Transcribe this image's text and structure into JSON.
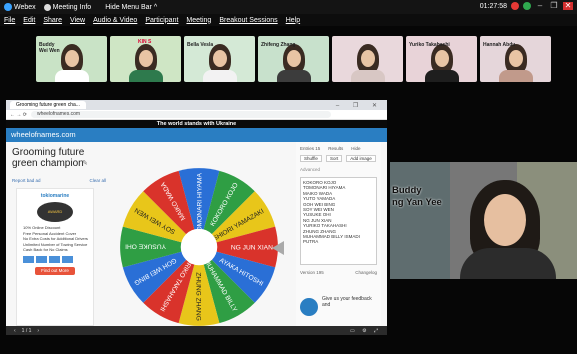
{
  "topbar": {
    "app_name": "Webex",
    "meeting_info": "Meeting Info",
    "hide_menu": "Hide Menu Bar",
    "hide_menu_chevron": "^",
    "timer": "01:27:58",
    "minimize": "–",
    "restore": "❐",
    "close": "✕"
  },
  "menu": [
    "File",
    "Edit",
    "Share",
    "View",
    "Audio & Video",
    "Participant",
    "Meeting",
    "Breakout Sessions",
    "Help"
  ],
  "participants": [
    {
      "name": "Buddy\nWei Wen",
      "bg": "#c9e3c6",
      "shirt": "#ffffff"
    },
    {
      "name": "",
      "badge": "KIN S",
      "bg": "#cfe6c5",
      "shirt": "#2e7a4d"
    },
    {
      "name": "Bella Vesla",
      "bg": "#d4e9d6",
      "shirt": "#f2f2f2"
    },
    {
      "name": "Zhifeng Zhang",
      "bg": "#c8e1cc",
      "shirt": "#3c3c3c"
    },
    {
      "name": "",
      "bg": "#e9d8dc",
      "shirt": "#d8c7c4"
    },
    {
      "name": "Yuriko Takahashi",
      "bg": "#e8d3d8",
      "shirt": "#1e1e1e"
    },
    {
      "name": "Hannah Abdu",
      "bg": "#e5d6da",
      "shirt": "#c19a8b"
    }
  ],
  "browser": {
    "tab_title": "Grooming future green cha...",
    "window_controls": "– ❐ ✕",
    "url": "wheelofnames.com",
    "banner": "The world stands with Ukraine",
    "site_name": "wheelofnames.com",
    "page_title": "Grooming future green champion",
    "report_ad": "Report bad ad",
    "clear_all": "Clear all"
  },
  "ad": {
    "brand": "tokiomarine",
    "award": "AWARD",
    "features": [
      "10% Online Discount",
      "Free Personal Accident Cover",
      "No Extra Costs for Additional Drivers",
      "Unlimited Number of Towing Service",
      "Cash Back for No Claims"
    ],
    "cta": "Find out More"
  },
  "wheel_names": [
    "TOMONARI HIYAMA",
    "KOKORO KOJO",
    "SHIORI YAMAZAKI",
    "NG JUN XIAN",
    "AYAKA HITOSHI",
    "MUHAMMAD BILLY",
    "ZHUNG ZHANG",
    "YURIKO TAKAHASHI",
    "GOH WEI BING",
    "YUSUKE OHI",
    "SOY WEI WEN",
    "MAIKO WADA"
  ],
  "wheel_colors": [
    "#2a6fd6",
    "#2f9e44",
    "#e8c61a",
    "#d9332b"
  ],
  "panel": {
    "tabs": [
      "Entries 15",
      "Results",
      "Hide"
    ],
    "buttons": [
      "Shuffle",
      "Sort",
      "Add image"
    ],
    "advanced": "Advanced",
    "entries": [
      "KOKORO KOJO",
      "TOMONARI HIYAMA",
      "MAIKO WADA",
      "YUTO YAMADA",
      "GOH WEI BING",
      "SOY WEI WEN",
      "YUSUKE OHI",
      "NG JUN XIAN",
      "YURIKO TAKAHASHI",
      "ZHUNG ZHANG",
      "MUHAMMAD BILLY ISMADI",
      "PUTRA"
    ],
    "version": "Version 195",
    "changelog": "Changelog",
    "promo": "Give us your feedback and"
  },
  "share_bar": {
    "page_counter": "1 / 1",
    "icons": "▭ ⚙ ⤢"
  },
  "big_video": {
    "name": "Buddy\nng Yan Yee"
  }
}
